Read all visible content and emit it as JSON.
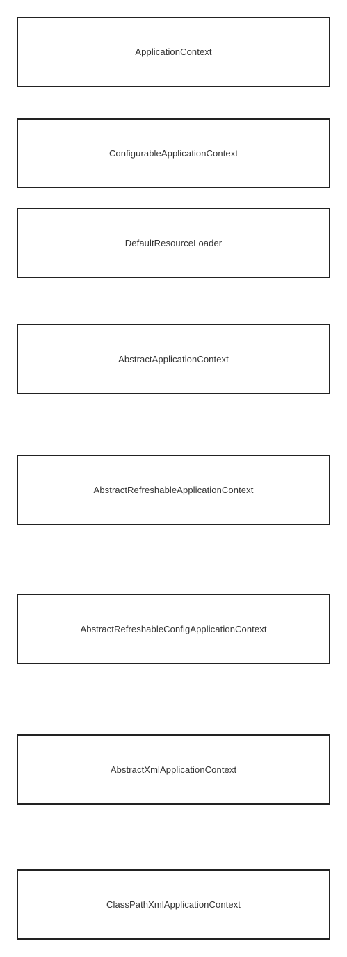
{
  "nodes": [
    {
      "label": "ApplicationContext"
    },
    {
      "label": "ConfigurableApplicationContext"
    },
    {
      "label": "DefaultResourceLoader"
    },
    {
      "label": "AbstractApplicationContext"
    },
    {
      "label": "AbstractRefreshableApplicationContext"
    },
    {
      "label": "AbstractRefreshableConfigApplicationContext"
    },
    {
      "label": "AbstractXmlApplicationContext"
    },
    {
      "label": "ClassPathXmlApplicationContext"
    }
  ],
  "colors": {
    "border": "#222222",
    "text": "#333333",
    "background": "#ffffff"
  }
}
